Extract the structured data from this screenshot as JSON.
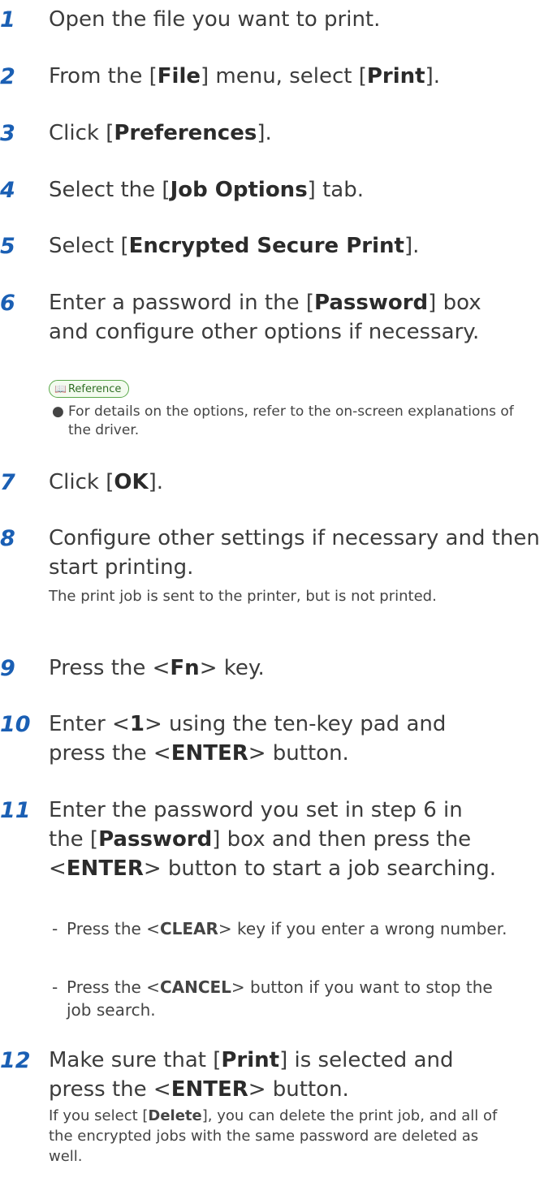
{
  "steps": [
    {
      "num": "1",
      "parts": [
        {
          "t": "Open the file you want to print."
        }
      ]
    },
    {
      "num": "2",
      "parts": [
        {
          "t": "From the ["
        },
        {
          "t": "File",
          "b": true
        },
        {
          "t": "] menu, select ["
        },
        {
          "t": "Print",
          "b": true
        },
        {
          "t": "]."
        }
      ]
    },
    {
      "num": "3",
      "parts": [
        {
          "t": "Click ["
        },
        {
          "t": "Preferences",
          "b": true
        },
        {
          "t": "]."
        }
      ]
    },
    {
      "num": "4",
      "parts": [
        {
          "t": "Select the ["
        },
        {
          "t": "Job Options",
          "b": true
        },
        {
          "t": "] tab."
        }
      ]
    },
    {
      "num": "5",
      "parts": [
        {
          "t": "Select ["
        },
        {
          "t": "Encrypted Secure Print",
          "b": true
        },
        {
          "t": "]."
        }
      ]
    },
    {
      "num": "6",
      "parts": [
        {
          "t": "Enter a password in the ["
        },
        {
          "t": "Password",
          "b": true
        },
        {
          "t": "] box and configure other options if necessary."
        }
      ]
    },
    {
      "num": "7",
      "parts": [
        {
          "t": "Click ["
        },
        {
          "t": "OK",
          "b": true
        },
        {
          "t": "]."
        }
      ]
    },
    {
      "num": "8",
      "parts": [
        {
          "t": "Configure other settings if necessary and then start printing."
        }
      ]
    },
    {
      "num": "9",
      "parts": [
        {
          "t": "Press the <"
        },
        {
          "t": "Fn",
          "b": true
        },
        {
          "t": "> key."
        }
      ]
    },
    {
      "num": "10",
      "parts": [
        {
          "t": "Enter <"
        },
        {
          "t": "1",
          "b": true
        },
        {
          "t": "> using the ten-key pad and press the <"
        },
        {
          "t": "ENTER",
          "b": true
        },
        {
          "t": "> button."
        }
      ]
    },
    {
      "num": "11",
      "parts": [
        {
          "t": "Enter the password you set in step 6 in the ["
        },
        {
          "t": "Password",
          "b": true
        },
        {
          "t": "] box and then press the <"
        },
        {
          "t": "ENTER",
          "b": true
        },
        {
          "t": "> button to start a job searching."
        }
      ]
    },
    {
      "num": "12",
      "parts": [
        {
          "t": "Make sure that ["
        },
        {
          "t": "Print",
          "b": true
        },
        {
          "t": "] is selected and press the <"
        },
        {
          "t": "ENTER",
          "b": true
        },
        {
          "t": "> button."
        }
      ]
    }
  ],
  "reference": {
    "badge_label": "Reference",
    "bullet": "For details on the options, refer to the on-screen explanations of the driver."
  },
  "step8_note": "The print job is sent to the printer, but is not printed.",
  "step11_notes": [
    [
      {
        "t": "Press the <"
      },
      {
        "t": "CLEAR",
        "b": true
      },
      {
        "t": "> key if you enter a wrong number."
      }
    ],
    [
      {
        "t": "Press the <"
      },
      {
        "t": "CANCEL",
        "b": true
      },
      {
        "t": "> button if you want to stop the job search."
      }
    ]
  ],
  "step12_note": [
    {
      "t": "If you select ["
    },
    {
      "t": "Delete",
      "b": true
    },
    {
      "t": "], you can delete the print job, and all of the encrypted jobs with the same password are deleted as well."
    }
  ]
}
